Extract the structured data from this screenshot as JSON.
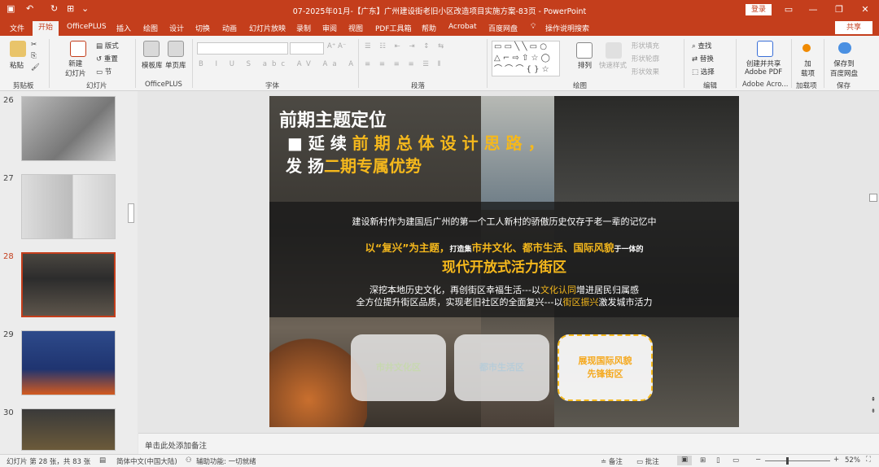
{
  "titlebar": {
    "doc_title": "07-2025年01月-【广东】广州建设街老旧小区改造项目实施方案-83页 - PowerPoint",
    "login": "登录"
  },
  "menu": {
    "file": "文件",
    "tabs": [
      "开始",
      "OfficePLUS",
      "插入",
      "绘图",
      "设计",
      "切换",
      "动画",
      "幻灯片放映",
      "录制",
      "审阅",
      "视图",
      "PDF工具箱",
      "帮助",
      "Acrobat",
      "百度网盘"
    ],
    "search": "操作说明搜索",
    "share": "共享"
  },
  "ribbon": {
    "clipboard": {
      "paste": "粘贴",
      "label": "剪贴板"
    },
    "slides": {
      "new_slide": "新建\n幻灯片",
      "layout": "版式",
      "reset": "重置",
      "section": "节",
      "label": "幻灯片"
    },
    "officeplus": {
      "template": "模板库",
      "single": "单页库",
      "label": "OfficePLUS"
    },
    "font": {
      "label": "字体"
    },
    "paragraph": {
      "label": "段落"
    },
    "drawing": {
      "arrange": "排列",
      "quick_styles": "快速样式",
      "shape_fill": "形状填充",
      "shape_outline": "形状轮廓",
      "shape_effect": "形状效果",
      "label": "绘图"
    },
    "editing": {
      "find": "查找",
      "replace": "替换",
      "select": "选择",
      "label": "编辑"
    },
    "adobe": {
      "create": "创建并共享\nAdobe PDF",
      "label": "Adobe Acro..."
    },
    "addin": {
      "add": "加\n载项",
      "label": "加载项"
    },
    "save": {
      "save_baidu": "保存到\n百度网盘",
      "label": "保存"
    }
  },
  "thumbnails": [
    {
      "num": "26"
    },
    {
      "num": "27"
    },
    {
      "num": "28"
    },
    {
      "num": "29"
    },
    {
      "num": "30"
    }
  ],
  "slide": {
    "heading": "前期主题定位",
    "line1_white": "■ 延 续 ",
    "line1_yellow": "前 期 总 体 设 计 思 路 ，",
    "line2_white": "发 扬",
    "line2_yellow": "二期专属优势",
    "intro": "建设新村作为建国后广州的第一个工人新村的骄傲历史仅存于老一辈的记忆中",
    "theme_prefix": "以“复兴”为主题，",
    "theme_mid": "打造集",
    "theme_highlight": "市井文化、都市生活、国际风貌",
    "theme_suffix": "于一体的",
    "theme_title": "现代开放式活力街区",
    "desc1_a": "深挖本地历史文化，再创街区幸福生活---以",
    "desc1_hl": "文化认同",
    "desc1_b": "增进居民归属感",
    "desc2_a": "全方位提升街区品质，实现老旧社区的全面复兴---以",
    "desc2_hl": "街区振兴",
    "desc2_b": "激发城市活力",
    "card1": "市井文化区",
    "card2": "都市生活区",
    "card3_line1": "展现国际风貌",
    "card3_line2": "先锋街区"
  },
  "notes_placeholder": "单击此处添加备注",
  "status": {
    "slide_info": "幻灯片 第 28 张，共 83 张",
    "language": "简体中文(中国大陆)",
    "accessibility": "辅助功能: 一切就绪",
    "notes": "备注",
    "comments": "批注",
    "zoom": "52%"
  },
  "colors": {
    "accent": "#c43e1c",
    "highlight": "#f5b81c"
  }
}
